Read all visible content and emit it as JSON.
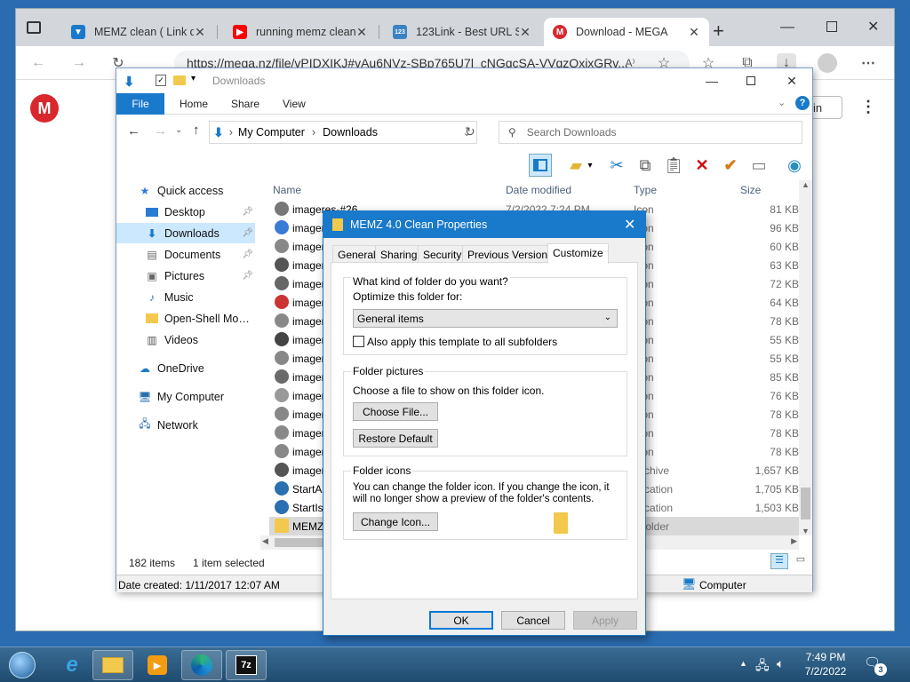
{
  "browser": {
    "tabs": [
      {
        "label": "MEMZ clean ( Link do",
        "fav": "mega-tab-icon"
      },
      {
        "label": "running memz clean (",
        "fav": "youtube-icon"
      },
      {
        "label": "123Link - Best URL Sh",
        "fav": "link-icon"
      },
      {
        "label": "Download - MEGA",
        "fav": "mega-icon"
      }
    ],
    "new_tab": "+",
    "url": "https://mega.nz/file/vPIDXIKJ#vAu6NVz-SBp765U7l_cNGqcSA-VVqzQxixGRv...",
    "mega_logo": "M",
    "signin": "in",
    "kebab": "⋮"
  },
  "explorer": {
    "title": "Downloads",
    "ribbon_tabs": [
      "File",
      "Home",
      "Share",
      "View"
    ],
    "path": [
      "My Computer",
      "Downloads"
    ],
    "search_placeholder": "Search Downloads",
    "nav": [
      {
        "label": "Quick access",
        "icon": "star-icon"
      },
      {
        "label": "Desktop",
        "icon": "desktop-icon",
        "pinned": true
      },
      {
        "label": "Downloads",
        "icon": "download-icon",
        "pinned": true,
        "selected": true
      },
      {
        "label": "Documents",
        "icon": "documents-icon",
        "pinned": true
      },
      {
        "label": "Pictures",
        "icon": "pictures-icon",
        "pinned": true
      },
      {
        "label": "Music",
        "icon": "music-icon"
      },
      {
        "label": "Open-Shell Modern",
        "icon": "folder-icon"
      },
      {
        "label": "Videos",
        "icon": "videos-icon"
      },
      {
        "label": "OneDrive",
        "icon": "cloud-icon"
      },
      {
        "label": "My Computer",
        "icon": "computer-icon"
      },
      {
        "label": "Network",
        "icon": "network-icon"
      }
    ],
    "columns": [
      "Name",
      "Date modified",
      "Type",
      "Size"
    ],
    "files": [
      {
        "name": "imageres-#26",
        "date": "7/2/2022 7:24 PM",
        "type": "Icon",
        "size": "81 KB"
      },
      {
        "name": "imageres-#27",
        "date": "",
        "type": "Icon",
        "size": "96 KB"
      },
      {
        "name": "imageres-#28",
        "date": "",
        "type": "Icon",
        "size": "60 KB"
      },
      {
        "name": "imageres-#29",
        "date": "",
        "type": "Icon",
        "size": "63 KB"
      },
      {
        "name": "imageres-#30",
        "date": "",
        "type": "Icon",
        "size": "72 KB"
      },
      {
        "name": "imageres-#31",
        "date": "",
        "type": "Icon",
        "size": "64 KB"
      },
      {
        "name": "imageres-#32",
        "date": "",
        "type": "Icon",
        "size": "78 KB"
      },
      {
        "name": "imageres-#33",
        "date": "",
        "type": "Icon",
        "size": "55 KB"
      },
      {
        "name": "imageres-#34",
        "date": "",
        "type": "Icon",
        "size": "55 KB"
      },
      {
        "name": "imageres-#35",
        "date": "",
        "type": "Icon",
        "size": "85 KB"
      },
      {
        "name": "imageres-#36",
        "date": "",
        "type": "Icon",
        "size": "76 KB"
      },
      {
        "name": "imageres-#37",
        "date": "",
        "type": "Icon",
        "size": "78 KB"
      },
      {
        "name": "imageres-#38",
        "date": "",
        "type": "Icon",
        "size": "78 KB"
      },
      {
        "name": "imageres-#39",
        "date": "",
        "type": "Icon",
        "size": "78 KB"
      },
      {
        "name": "imageres",
        "date": "",
        "type": "Archive",
        "size": "1,657 KB"
      },
      {
        "name": "StartAl",
        "date": "",
        "type": "plication",
        "size": "1,705 KB"
      },
      {
        "name": "StartIsB",
        "date": "",
        "type": "plication",
        "size": "1,503 KB"
      },
      {
        "name": "MEMZ",
        "date": "",
        "type": "e folder",
        "size": "",
        "selected": true
      }
    ],
    "items_count": "182 items",
    "selected_count": "1 item selected",
    "date_created": "Date created: 1/11/2017 12:07 AM",
    "computer_label": "Computer"
  },
  "dialog": {
    "title": "MEMZ 4.0 Clean Properties",
    "tabs": [
      "General",
      "Sharing",
      "Security",
      "Previous Versions",
      "Customize"
    ],
    "what_kind": "What kind of folder do you want?",
    "optimize": "Optimize this folder for:",
    "optimize_value": "General items",
    "apply_sub": "Also apply this template to all subfolders",
    "folder_pictures": "Folder pictures",
    "choose_text": "Choose a file to show on this folder icon.",
    "choose_btn": "Choose File...",
    "restore_btn": "Restore Default",
    "folder_icons": "Folder icons",
    "icons_text": "You can change the folder icon. If you change the icon, it will no longer show a preview of the folder's contents.",
    "change_btn": "Change Icon...",
    "ok": "OK",
    "cancel": "Cancel",
    "apply": "Apply"
  },
  "taskbar": {
    "time": "7:49 PM",
    "date": "7/2/2022",
    "notifications": "3",
    "apps": [
      "start-orb",
      "ie-icon",
      "explorer-icon",
      "media-player-icon",
      "edge-icon",
      "7zip-icon"
    ],
    "sevenzip_label": "7z"
  },
  "colors": {
    "accent": "#1979ca",
    "mega_red": "#d9272e",
    "selection": "#cce8ff"
  }
}
